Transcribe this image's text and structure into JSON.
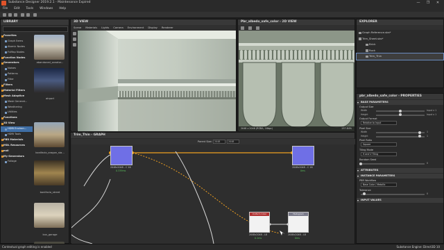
{
  "app": {
    "title": "Substance Designer 2019.2.1 - Maintenance Expired",
    "menu": [
      "File",
      "Edit",
      "Tools",
      "Windows",
      "Help"
    ],
    "window_controls": [
      "—",
      "❐",
      "✕"
    ]
  },
  "library": {
    "title": "LIBRARY",
    "tree": [
      {
        "label": "Favorites",
        "cat": true
      },
      {
        "label": "Graph Items",
        "cat": false
      },
      {
        "label": "Atomic Nodes",
        "cat": false
      },
      {
        "label": "FxMap Nodes",
        "cat": false
      },
      {
        "label": "Function Nodes",
        "cat": true
      },
      {
        "label": "Generators",
        "cat": true
      },
      {
        "label": "Noises",
        "cat": false
      },
      {
        "label": "Patterns",
        "cat": false
      },
      {
        "label": "Filter",
        "cat": false
      },
      {
        "label": "Filters",
        "cat": true
      },
      {
        "label": "Material Filters",
        "cat": true
      },
      {
        "label": "Mesh Adaptive",
        "cat": true
      },
      {
        "label": "Mask Generat...",
        "cat": false
      },
      {
        "label": "Weathering",
        "cat": false
      },
      {
        "label": "Utilities",
        "cat": false
      },
      {
        "label": "Functions",
        "cat": true
      },
      {
        "label": "3D View",
        "cat": true
      },
      {
        "label": "HDRI Environ...",
        "cat": false,
        "selected": true
      },
      {
        "label": "HDRI Tools",
        "cat": false
      },
      {
        "label": "PBR Materials",
        "cat": true
      },
      {
        "label": "MDL Resources",
        "cat": true
      },
      {
        "label": "mdl",
        "cat": true
      },
      {
        "label": "My Generators",
        "cat": true
      },
      {
        "label": "Foliage",
        "cat": false
      }
    ],
    "thumbnails": [
      "abandoned_sanator...",
      "airport",
      "bonifacio_aragon_sta...",
      "bonifacio_street",
      "bus_garage"
    ]
  },
  "view3d": {
    "title": "3D VIEW",
    "menu": [
      "Scene",
      "Materials",
      "Lights",
      "Camera",
      "Environment",
      "Display",
      "Renderer"
    ]
  },
  "view2d": {
    "title": "Pbr_albedo_safe_color - 2D VIEW",
    "status": "2048 x 2048 (RGBA, 16bpc)",
    "zoom": "237.84%"
  },
  "explorer": {
    "title": "EXPLORER",
    "items": [
      {
        "label": "Graph Reference.sbs*",
        "indent": 0
      },
      {
        "label": "Trim_Sheet.sbs*",
        "indent": 0
      },
      {
        "label": "Brick",
        "indent": 2
      },
      {
        "label": "Rock",
        "indent": 2
      },
      {
        "label": "Trim_Thin",
        "indent": 2,
        "selected": true
      }
    ]
  },
  "properties": {
    "title": "pbr_albedo_safe_color - PROPERTIES",
    "sections": {
      "base": "BASE PARAMETERS",
      "attributes": "ATTRIBUTES",
      "instance": "INSTANCE PARAMETERS",
      "input_values": "INPUT VALUES"
    },
    "output_size": {
      "label": "Output Size",
      "rows": [
        {
          "name": "Width",
          "value": "Input x 1",
          "level": 0.5
        },
        {
          "name": "Height",
          "value": "Input x 1",
          "level": 0.5
        }
      ]
    },
    "output_format": {
      "label": "Output Format",
      "value": "Relative to Input"
    },
    "pixel_size": {
      "label": "Pixel Size",
      "rows": [
        {
          "name": "Width",
          "value": "1",
          "level": 0.9
        },
        {
          "name": "Height",
          "value": "1",
          "level": 0.9
        }
      ]
    },
    "pixel_ratio": {
      "label": "Pixel Ratio",
      "value": "Square"
    },
    "tiling_mode": {
      "label": "Tiling Mode",
      "value": "H and V Tiling"
    },
    "random_seed": {
      "label": "Random Seed",
      "value": "0",
      "level": 0.0
    },
    "pbr_workflow": {
      "label": "PBR Workflow",
      "value": "Base Color / Metallic"
    },
    "tolerance": {
      "label": "Tolerance",
      "value": "0",
      "level": 0.05
    }
  },
  "graph": {
    "title": "Trim_Thin - GRAPH",
    "parent_size_label": "Parent Size:",
    "parent_size_a": "2048",
    "parent_size_b": "2048",
    "nodes": {
      "a": {
        "caption": "2048x2048 - C 16",
        "time": "0.339ms"
      },
      "b": {
        "caption": "2048x2048 - C 16",
        "time": "0ms"
      },
      "c": {
        "header": "Uniform Color",
        "caption": "2048x2048 - L8",
        "time": "0.1ms"
      },
      "d": {
        "header": "Histogram",
        "caption": "2048x2048 - L8",
        "time": "0ms"
      }
    }
  },
  "status": {
    "left": "Contextual graph editing is enabled",
    "right": "Substance Engine: Direct3D 10"
  },
  "colors": {
    "accent": "#3f6ea5",
    "node_blue": "#6f6fe6",
    "wire_orange": "#f0a020",
    "ok_green": "#59c05a",
    "red_header": "#b03030"
  }
}
